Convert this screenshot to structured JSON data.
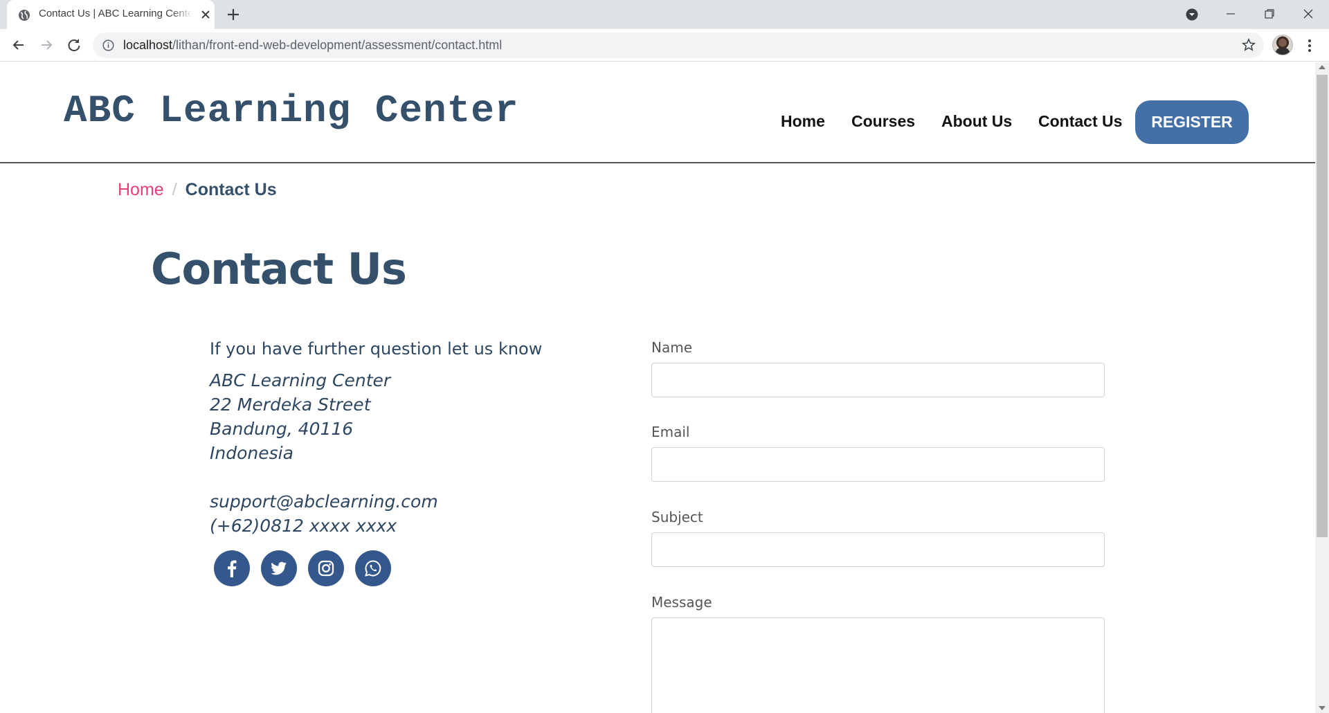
{
  "browser": {
    "tab_title": "Contact Us | ABC Learning Center",
    "url_host": "localhost",
    "url_path": "/lithan/front-end-web-development/assessment/contact.html",
    "icons": [
      "globe-icon",
      "close-icon",
      "plus-icon",
      "tab-search-icon",
      "minimize-icon",
      "restore-icon",
      "window-close-icon",
      "back-icon",
      "forward-icon",
      "reload-icon",
      "info-icon",
      "star-icon",
      "profile-avatar",
      "more-menu-icon"
    ]
  },
  "header": {
    "brand": "ABC Learning Center",
    "nav": [
      "Home",
      "Courses",
      "About Us",
      "Contact Us"
    ],
    "register_label": "REGISTER",
    "register_color": "#4270a7"
  },
  "breadcrumb": {
    "home": "Home",
    "separator": "/",
    "current": "Contact Us"
  },
  "page": {
    "title": "Contact Us",
    "accent_color": "#34506b",
    "link_color": "#e43f7c"
  },
  "contact": {
    "intro": "If you have further question let us know",
    "address": [
      "ABC Learning Center",
      "22 Merdeka Street",
      "Bandung, 40116",
      "Indonesia"
    ],
    "email": "support@abclearning.com",
    "phone": "(+62)0812 xxxx xxxx",
    "social": [
      "facebook-icon",
      "twitter-icon",
      "instagram-icon",
      "whatsapp-icon"
    ]
  },
  "form": {
    "name_label": "Name",
    "name_value": "",
    "email_label": "Email",
    "email_value": "",
    "subject_label": "Subject",
    "subject_value": "",
    "message_label": "Message",
    "message_value": ""
  }
}
